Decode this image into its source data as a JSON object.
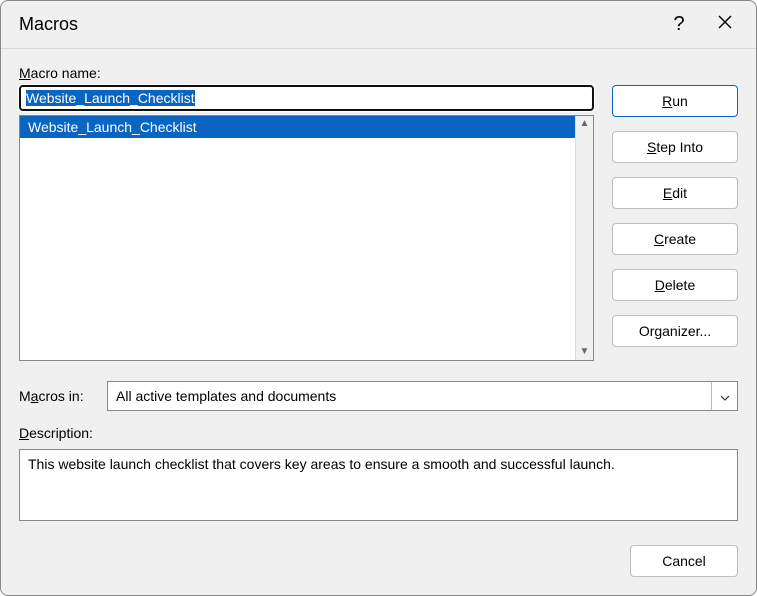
{
  "titlebar": {
    "title": "Macros",
    "help": "?",
    "close_icon": "close-icon"
  },
  "labels": {
    "macro_name_pre": "M",
    "macro_name_post": "acro name:",
    "macros_in_pre": "M",
    "macros_in_mid": "a",
    "macros_in_post": "cros in:",
    "description_pre": "D",
    "description_post": "escription:"
  },
  "macro_name_value": "Website_Launch_Checklist",
  "macro_list": [
    {
      "label": "Website_Launch_Checklist",
      "selected": true
    }
  ],
  "macros_in_value": "All active templates and documents",
  "description_text": "This website launch checklist that covers key areas to ensure a smooth and successful launch.",
  "buttons": {
    "run_u": "R",
    "run_rest": "un",
    "step_u": "S",
    "step_rest": "tep Into",
    "edit_u": "E",
    "edit_rest": "dit",
    "create_u": "C",
    "create_rest": "reate",
    "delete_u": "D",
    "delete_rest": "elete",
    "organizer": "Organizer...",
    "cancel": "Cancel"
  }
}
